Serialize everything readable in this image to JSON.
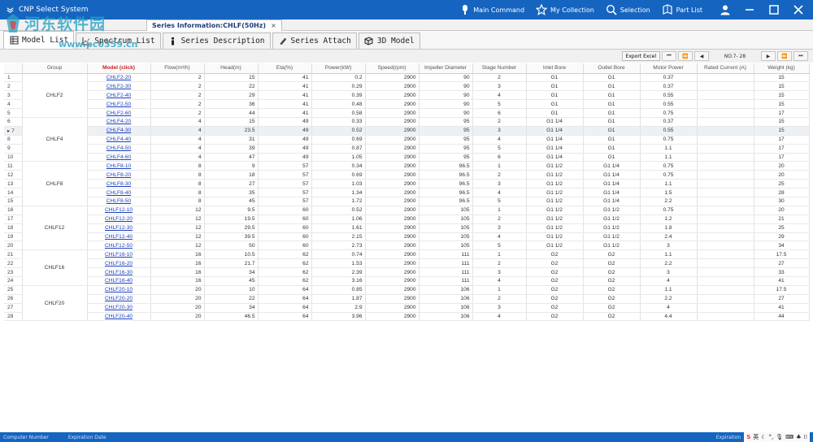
{
  "window": {
    "title": "CNP Select System",
    "menu": [
      {
        "label": "Main Command",
        "icon": "list-icon"
      },
      {
        "label": "My Collection",
        "icon": "star-icon"
      },
      {
        "label": "Selection",
        "icon": "search-icon"
      },
      {
        "label": "Part List",
        "icon": "book-icon"
      }
    ]
  },
  "watermark": {
    "text": "河东软件园",
    "url": "www.pc0359.cn"
  },
  "series_tab": {
    "label": "Series Information:CHLF(50Hz)",
    "close": "×"
  },
  "subtabs": [
    {
      "label": "Model List",
      "icon": "table-icon",
      "active": true
    },
    {
      "label": "Spectrum List",
      "icon": "chart-icon",
      "active": false
    },
    {
      "label": "Series Description",
      "icon": "info-icon",
      "active": false
    },
    {
      "label": "Series Attach",
      "icon": "paperclip-icon",
      "active": false
    },
    {
      "label": "3D Model",
      "icon": "cube-icon",
      "active": false
    }
  ],
  "toolbar": {
    "export_label": "Export Excel",
    "first": "⏮",
    "prev_page": "⏪",
    "prev": "◀",
    "record": "NO.7- 28",
    "next": "▶",
    "next_page": "⏩",
    "last": "⏭"
  },
  "table": {
    "columns": [
      "",
      "Group",
      "Model (click)",
      "Flow(m³/h)",
      "Head(m)",
      "Eta(%)",
      "Power(kW)",
      "Speed(rpm)",
      "Impeller Diameter",
      "Stage Number",
      "Inlet Bore",
      "Outlet Bore",
      "Motor Power",
      "Rated Current (A)",
      "Weight (kg)"
    ],
    "selected_row": 7,
    "groups": [
      {
        "name": "CHLF2",
        "rows": [
          {
            "no": "1",
            "model": "CHLF2-20",
            "flow": "2",
            "head": "15",
            "eta": "41",
            "power": "0.2",
            "speed": "2900",
            "imp": "90",
            "stage": "2",
            "inlet": "G1",
            "outlet": "G1",
            "motor": "0.37",
            "current": "",
            "weight": "15"
          },
          {
            "no": "2",
            "model": "CHLF2-30",
            "flow": "2",
            "head": "22",
            "eta": "41",
            "power": "0.29",
            "speed": "2900",
            "imp": "90",
            "stage": "3",
            "inlet": "G1",
            "outlet": "G1",
            "motor": "0.37",
            "current": "",
            "weight": "15"
          },
          {
            "no": "3",
            "model": "CHLF2-40",
            "flow": "2",
            "head": "29",
            "eta": "41",
            "power": "0.39",
            "speed": "2900",
            "imp": "90",
            "stage": "4",
            "inlet": "G1",
            "outlet": "G1",
            "motor": "0.55",
            "current": "",
            "weight": "15"
          },
          {
            "no": "4",
            "model": "CHLF2-50",
            "flow": "2",
            "head": "36",
            "eta": "41",
            "power": "0.48",
            "speed": "2900",
            "imp": "90",
            "stage": "5",
            "inlet": "G1",
            "outlet": "G1",
            "motor": "0.55",
            "current": "",
            "weight": "15"
          },
          {
            "no": "5",
            "model": "CHLF2-60",
            "flow": "2",
            "head": "44",
            "eta": "41",
            "power": "0.58",
            "speed": "2900",
            "imp": "90",
            "stage": "6",
            "inlet": "G1",
            "outlet": "G1",
            "motor": "0.75",
            "current": "",
            "weight": "17"
          }
        ]
      },
      {
        "name": "CHLF4",
        "rows": [
          {
            "no": "6",
            "model": "CHLF4-20",
            "flow": "4",
            "head": "15",
            "eta": "49",
            "power": "0.33",
            "speed": "2900",
            "imp": "95",
            "stage": "2",
            "inlet": "G1 1/4",
            "outlet": "G1",
            "motor": "0.37",
            "current": "",
            "weight": "15"
          },
          {
            "no": "7",
            "model": "CHLF4-30",
            "flow": "4",
            "head": "23.5",
            "eta": "49",
            "power": "0.52",
            "speed": "2900",
            "imp": "95",
            "stage": "3",
            "inlet": "G1 1/4",
            "outlet": "G1",
            "motor": "0.55",
            "current": "",
            "weight": "15"
          },
          {
            "no": "8",
            "model": "CHLF4-40",
            "flow": "4",
            "head": "31",
            "eta": "49",
            "power": "0.69",
            "speed": "2900",
            "imp": "95",
            "stage": "4",
            "inlet": "G1 1/4",
            "outlet": "G1",
            "motor": "0.75",
            "current": "",
            "weight": "17"
          },
          {
            "no": "9",
            "model": "CHLF4-50",
            "flow": "4",
            "head": "39",
            "eta": "49",
            "power": "0.87",
            "speed": "2900",
            "imp": "95",
            "stage": "5",
            "inlet": "G1 1/4",
            "outlet": "G1",
            "motor": "1.1",
            "current": "",
            "weight": "17"
          },
          {
            "no": "10",
            "model": "CHLF4-60",
            "flow": "4",
            "head": "47",
            "eta": "49",
            "power": "1.05",
            "speed": "2900",
            "imp": "95",
            "stage": "6",
            "inlet": "G1 1/4",
            "outlet": "G1",
            "motor": "1.1",
            "current": "",
            "weight": "17"
          }
        ]
      },
      {
        "name": "CHLF8",
        "rows": [
          {
            "no": "11",
            "model": "CHLF8-10",
            "flow": "8",
            "head": "9",
            "eta": "57",
            "power": "0.34",
            "speed": "2900",
            "imp": "96.5",
            "stage": "1",
            "inlet": "G1 1/2",
            "outlet": "G1 1/4",
            "motor": "0.75",
            "current": "",
            "weight": "20"
          },
          {
            "no": "12",
            "model": "CHLF8-20",
            "flow": "8",
            "head": "18",
            "eta": "57",
            "power": "0.69",
            "speed": "2900",
            "imp": "96.5",
            "stage": "2",
            "inlet": "G1 1/2",
            "outlet": "G1 1/4",
            "motor": "0.75",
            "current": "",
            "weight": "20"
          },
          {
            "no": "13",
            "model": "CHLF8-30",
            "flow": "8",
            "head": "27",
            "eta": "57",
            "power": "1.03",
            "speed": "2900",
            "imp": "96.5",
            "stage": "3",
            "inlet": "G1 1/2",
            "outlet": "G1 1/4",
            "motor": "1.1",
            "current": "",
            "weight": "25"
          },
          {
            "no": "14",
            "model": "CHLF8-40",
            "flow": "8",
            "head": "35",
            "eta": "57",
            "power": "1.34",
            "speed": "2900",
            "imp": "96.5",
            "stage": "4",
            "inlet": "G1 1/2",
            "outlet": "G1 1/4",
            "motor": "1.5",
            "current": "",
            "weight": "28"
          },
          {
            "no": "15",
            "model": "CHLF8-50",
            "flow": "8",
            "head": "45",
            "eta": "57",
            "power": "1.72",
            "speed": "2900",
            "imp": "96.5",
            "stage": "5",
            "inlet": "G1 1/2",
            "outlet": "G1 1/4",
            "motor": "2.2",
            "current": "",
            "weight": "30"
          }
        ]
      },
      {
        "name": "CHLF12",
        "rows": [
          {
            "no": "16",
            "model": "CHLF12-10",
            "flow": "12",
            "head": "9.5",
            "eta": "60",
            "power": "0.52",
            "speed": "2900",
            "imp": "105",
            "stage": "1",
            "inlet": "G1 1/2",
            "outlet": "G1 1/2",
            "motor": "0.75",
            "current": "",
            "weight": "20"
          },
          {
            "no": "17",
            "model": "CHLF12-20",
            "flow": "12",
            "head": "19.5",
            "eta": "60",
            "power": "1.06",
            "speed": "2900",
            "imp": "105",
            "stage": "2",
            "inlet": "G1 1/2",
            "outlet": "G1 1/2",
            "motor": "1.2",
            "current": "",
            "weight": "21"
          },
          {
            "no": "18",
            "model": "CHLF12-30",
            "flow": "12",
            "head": "29.5",
            "eta": "60",
            "power": "1.61",
            "speed": "2900",
            "imp": "105",
            "stage": "3",
            "inlet": "G1 1/2",
            "outlet": "G1 1/2",
            "motor": "1.8",
            "current": "",
            "weight": "25"
          },
          {
            "no": "19",
            "model": "CHLF12-40",
            "flow": "12",
            "head": "39.5",
            "eta": "60",
            "power": "2.15",
            "speed": "2900",
            "imp": "105",
            "stage": "4",
            "inlet": "G1 1/2",
            "outlet": "G1 1/2",
            "motor": "2.4",
            "current": "",
            "weight": "29"
          },
          {
            "no": "20",
            "model": "CHLF12-50",
            "flow": "12",
            "head": "50",
            "eta": "60",
            "power": "2.73",
            "speed": "2900",
            "imp": "105",
            "stage": "5",
            "inlet": "G1 1/2",
            "outlet": "G1 1/2",
            "motor": "3",
            "current": "",
            "weight": "34"
          }
        ]
      },
      {
        "name": "CHLF16",
        "rows": [
          {
            "no": "21",
            "model": "CHLF16-10",
            "flow": "16",
            "head": "10.5",
            "eta": "62",
            "power": "0.74",
            "speed": "2900",
            "imp": "111",
            "stage": "1",
            "inlet": "G2",
            "outlet": "G2",
            "motor": "1.1",
            "current": "",
            "weight": "17.5"
          },
          {
            "no": "22",
            "model": "CHLF16-20",
            "flow": "16",
            "head": "21.7",
            "eta": "62",
            "power": "1.53",
            "speed": "2900",
            "imp": "111",
            "stage": "2",
            "inlet": "G2",
            "outlet": "G2",
            "motor": "2.2",
            "current": "",
            "weight": "27"
          },
          {
            "no": "23",
            "model": "CHLF16-30",
            "flow": "16",
            "head": "34",
            "eta": "62",
            "power": "2.39",
            "speed": "2900",
            "imp": "111",
            "stage": "3",
            "inlet": "G2",
            "outlet": "G2",
            "motor": "3",
            "current": "",
            "weight": "33"
          },
          {
            "no": "24",
            "model": "CHLF16-40",
            "flow": "16",
            "head": "45",
            "eta": "62",
            "power": "3.16",
            "speed": "2900",
            "imp": "111",
            "stage": "4",
            "inlet": "G2",
            "outlet": "G2",
            "motor": "4",
            "current": "",
            "weight": "41"
          }
        ]
      },
      {
        "name": "CHLF20",
        "rows": [
          {
            "no": "25",
            "model": "CHLF20-10",
            "flow": "20",
            "head": "10",
            "eta": "64",
            "power": "0.85",
            "speed": "2900",
            "imp": "106",
            "stage": "1",
            "inlet": "G2",
            "outlet": "G2",
            "motor": "1.1",
            "current": "",
            "weight": "17.5"
          },
          {
            "no": "26",
            "model": "CHLF20-20",
            "flow": "20",
            "head": "22",
            "eta": "64",
            "power": "1.87",
            "speed": "2900",
            "imp": "106",
            "stage": "2",
            "inlet": "G2",
            "outlet": "G2",
            "motor": "2.2",
            "current": "",
            "weight": "27"
          },
          {
            "no": "27",
            "model": "CHLF20-30",
            "flow": "20",
            "head": "34",
            "eta": "64",
            "power": "2.9",
            "speed": "2900",
            "imp": "106",
            "stage": "3",
            "inlet": "G2",
            "outlet": "G2",
            "motor": "4",
            "current": "",
            "weight": "41"
          },
          {
            "no": "28",
            "model": "CHLF20-40",
            "flow": "20",
            "head": "46.5",
            "eta": "64",
            "power": "3.96",
            "speed": "2900",
            "imp": "106",
            "stage": "4",
            "inlet": "G2",
            "outlet": "G2",
            "motor": "4.4",
            "current": "",
            "weight": "44"
          }
        ]
      }
    ]
  },
  "statusbar": {
    "left1": "Computer Number",
    "left2": "Expiration Date",
    "right": "Expiration",
    "ime": {
      "s": "S",
      "lang": "英"
    }
  },
  "colors": {
    "titlebar": "#1565c0",
    "link": "#1a3fc0",
    "model_header": "#c81e1e",
    "watermark": "#2aa2c4"
  }
}
